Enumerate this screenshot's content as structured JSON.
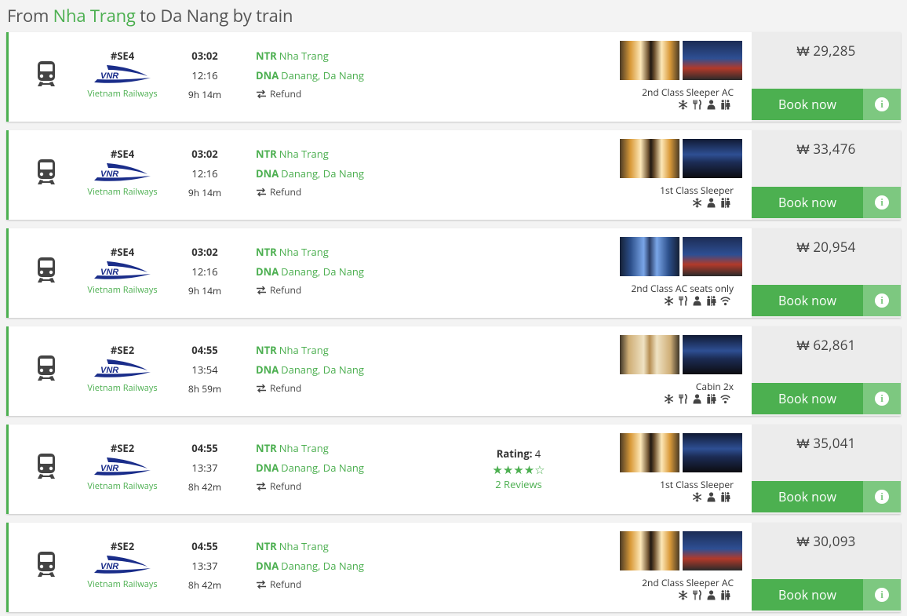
{
  "header": {
    "prefix": "From",
    "from_city": "Nha Trang",
    "middle": "to",
    "suffix": "Da Nang by train"
  },
  "colors": {
    "accent": "#4cb050",
    "accent_light": "#7dc880",
    "price_bg": "#ececec"
  },
  "common": {
    "operator": "Vietnam Railways",
    "book_label": "Book now",
    "info_label": "i",
    "refund_label": "Refund",
    "from_code": "NTR",
    "from_name": "Nha Trang",
    "to_code": "DNA",
    "to_name": "Danang, Da Nang"
  },
  "trips": [
    {
      "train": "#SE4",
      "dep": "03:02",
      "arr": "12:16",
      "dur": "9h 14m",
      "class": "2nd Class Sleeper AC",
      "price": "₩ 29,285",
      "amenities": [
        "snowflake-icon",
        "utensils-icon",
        "seat-icon",
        "toilet-icon"
      ],
      "photo1": "interior",
      "photo2": "exterior"
    },
    {
      "train": "#SE4",
      "dep": "03:02",
      "arr": "12:16",
      "dur": "9h 14m",
      "class": "1st Class Sleeper",
      "price": "₩ 33,476",
      "amenities": [
        "snowflake-icon",
        "seat-icon",
        "toilet-icon"
      ],
      "photo1": "interior",
      "photo2": "crew"
    },
    {
      "train": "#SE4",
      "dep": "03:02",
      "arr": "12:16",
      "dur": "9h 14m",
      "class": "2nd Class AC seats only",
      "price": "₩ 20,954",
      "amenities": [
        "snowflake-icon",
        "utensils-icon",
        "seat-icon",
        "toilet-icon",
        "wifi-icon"
      ],
      "photo1": "blue",
      "photo2": "exterior"
    },
    {
      "train": "#SE2",
      "dep": "04:55",
      "arr": "13:54",
      "dur": "8h 59m",
      "class": "Cabin 2x",
      "price": "₩ 62,861",
      "amenities": [
        "snowflake-icon",
        "utensils-icon",
        "seat-icon",
        "toilet-icon",
        "wifi-icon"
      ],
      "photo1": "cabin",
      "photo2": "crew"
    },
    {
      "train": "#SE2",
      "dep": "04:55",
      "arr": "13:37",
      "dur": "8h 42m",
      "class": "1st Class Sleeper",
      "price": "₩ 35,041",
      "amenities": [
        "snowflake-icon",
        "seat-icon",
        "toilet-icon"
      ],
      "photo1": "interior",
      "photo2": "crew",
      "rating": {
        "label": "Rating:",
        "value": "4",
        "stars": 4,
        "max": 5,
        "reviews": "2 Reviews"
      }
    },
    {
      "train": "#SE2",
      "dep": "04:55",
      "arr": "13:37",
      "dur": "8h 42m",
      "class": "2nd Class Sleeper AC",
      "price": "₩ 30,093",
      "amenities": [
        "snowflake-icon",
        "utensils-icon",
        "seat-icon",
        "toilet-icon"
      ],
      "photo1": "interior",
      "photo2": "exterior"
    }
  ]
}
